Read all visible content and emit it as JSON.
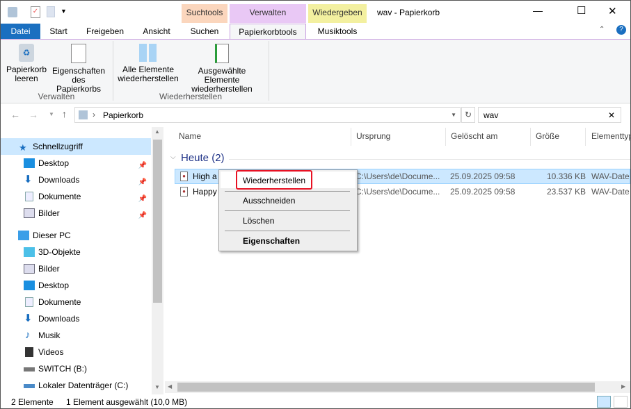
{
  "window": {
    "title": "wav - Papierkorb",
    "minimize": "—",
    "maximize": "☐",
    "close": "✕"
  },
  "context_tabs": {
    "search": "Suchtools",
    "manage": "Verwalten",
    "play": "Wiedergeben"
  },
  "tabs": {
    "file": "Datei",
    "start": "Start",
    "share": "Freigeben",
    "view": "Ansicht",
    "search": "Suchen",
    "bin": "Papierkorbtools",
    "music": "Musiktools"
  },
  "ribbon": {
    "empty": "Papierkorb leeren",
    "props": "Eigenschaften des Papierkorbs",
    "group_manage": "Verwalten",
    "restore_all": "Alle Elemente wiederherstellen",
    "restore_sel": "Ausgewählte Elemente wiederherstellen",
    "group_restore": "Wiederherstellen"
  },
  "address": {
    "path": "Papierkorb",
    "search_value": "wav",
    "clear": "✕"
  },
  "nav": {
    "quick": "Schnellzugriff",
    "quick_items": [
      "Desktop",
      "Downloads",
      "Dokumente",
      "Bilder"
    ],
    "pc": "Dieser PC",
    "pc_items": [
      "3D-Objekte",
      "Bilder",
      "Desktop",
      "Dokumente",
      "Downloads",
      "Musik",
      "Videos",
      "SWITCH (B:)",
      "Lokaler Datenträger (C:)"
    ]
  },
  "columns": {
    "name": "Name",
    "origin": "Ursprung",
    "deleted": "Gelöscht am",
    "size": "Größe",
    "type": "Elementtyp"
  },
  "group": "Heute (2)",
  "files": [
    {
      "name": "High a",
      "origin": "C:\\Users\\de\\Docume...",
      "deleted": "25.09.2025 09:58",
      "size": "10.336 KB",
      "type": "WAV-Date"
    },
    {
      "name": "Happy",
      "origin": "C:\\Users\\de\\Docume...",
      "deleted": "25.09.2025 09:58",
      "size": "23.537 KB",
      "type": "WAV-Date"
    }
  ],
  "context_menu": {
    "restore": "Wiederherstellen",
    "cut": "Ausschneiden",
    "delete": "Löschen",
    "properties": "Eigenschaften"
  },
  "status": {
    "count": "2 Elemente",
    "selected": "1 Element ausgewählt (10,0 MB)"
  },
  "colors": {
    "accent": "#1a6fc0",
    "selection": "#cce8ff",
    "highlight": "#e81123"
  }
}
